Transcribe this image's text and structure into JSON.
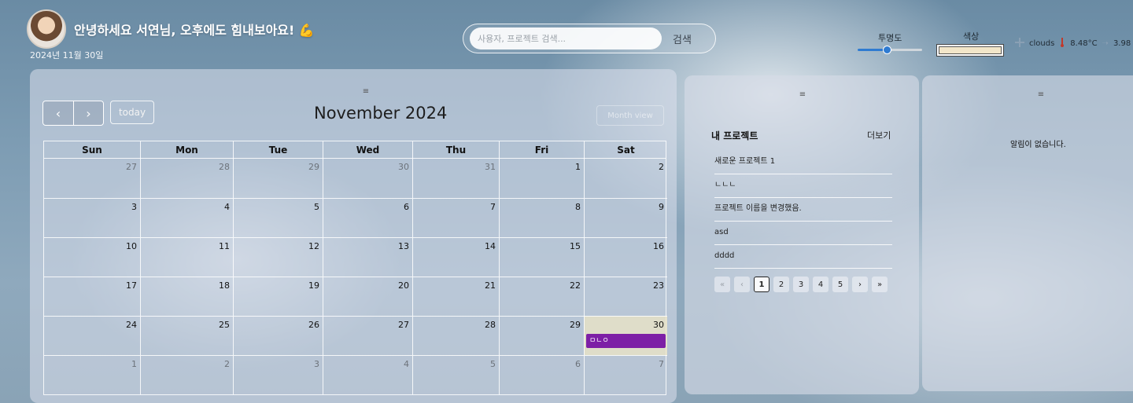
{
  "header": {
    "greeting": "안녕하세요 서연님, 오후에도 힘내보아요! 💪",
    "date": "2024년 11월 30일"
  },
  "search": {
    "placeholder": "사용자, 프로젝트 검색...",
    "button_label": "검색"
  },
  "controls": {
    "opacity_label": "투명도",
    "opacity_value": 0.45,
    "color_label": "색상",
    "color_value": "#f2e6c9"
  },
  "weather": {
    "icon": "cloud-icon",
    "condition": "clouds",
    "temperature": "8.48°C",
    "wind": "3.98"
  },
  "calendar": {
    "prev_icon": "chevron-left-icon",
    "next_icon": "chevron-right-icon",
    "today_label": "today",
    "title": "November 2024",
    "view_label": "Month view",
    "weekdays": [
      "Sun",
      "Mon",
      "Tue",
      "Wed",
      "Thu",
      "Fri",
      "Sat"
    ],
    "days": [
      {
        "n": "27",
        "other": true
      },
      {
        "n": "28",
        "other": true
      },
      {
        "n": "29",
        "other": true
      },
      {
        "n": "30",
        "other": true
      },
      {
        "n": "31",
        "other": true
      },
      {
        "n": "1"
      },
      {
        "n": "2"
      },
      {
        "n": "3"
      },
      {
        "n": "4"
      },
      {
        "n": "5"
      },
      {
        "n": "6"
      },
      {
        "n": "7"
      },
      {
        "n": "8"
      },
      {
        "n": "9"
      },
      {
        "n": "10"
      },
      {
        "n": "11"
      },
      {
        "n": "12"
      },
      {
        "n": "13"
      },
      {
        "n": "14"
      },
      {
        "n": "15"
      },
      {
        "n": "16"
      },
      {
        "n": "17"
      },
      {
        "n": "18"
      },
      {
        "n": "19"
      },
      {
        "n": "20"
      },
      {
        "n": "21"
      },
      {
        "n": "22"
      },
      {
        "n": "23"
      },
      {
        "n": "24"
      },
      {
        "n": "25"
      },
      {
        "n": "26"
      },
      {
        "n": "27"
      },
      {
        "n": "28"
      },
      {
        "n": "29"
      },
      {
        "n": "30",
        "today": true,
        "event": "ㅁㄴㅇ"
      },
      {
        "n": "1",
        "other": true
      },
      {
        "n": "2",
        "other": true
      },
      {
        "n": "3",
        "other": true
      },
      {
        "n": "4",
        "other": true
      },
      {
        "n": "5",
        "other": true
      },
      {
        "n": "6",
        "other": true
      },
      {
        "n": "7",
        "other": true
      }
    ],
    "event_color": "#7d1fa6"
  },
  "projects": {
    "title": "내 프로젝트",
    "more_label": "더보기",
    "items": [
      "새로운 프로젝트 1",
      "ㄴㄴㄴ",
      "프로젝트 이름을 변경했음.",
      "asd",
      "dddd"
    ],
    "pagination": {
      "first": "«",
      "prev": "‹",
      "pages": [
        "1",
        "2",
        "3",
        "4",
        "5"
      ],
      "current": "1",
      "next": "›",
      "last": "»"
    }
  },
  "notifications": {
    "empty_text": "알림이 없습니다."
  }
}
